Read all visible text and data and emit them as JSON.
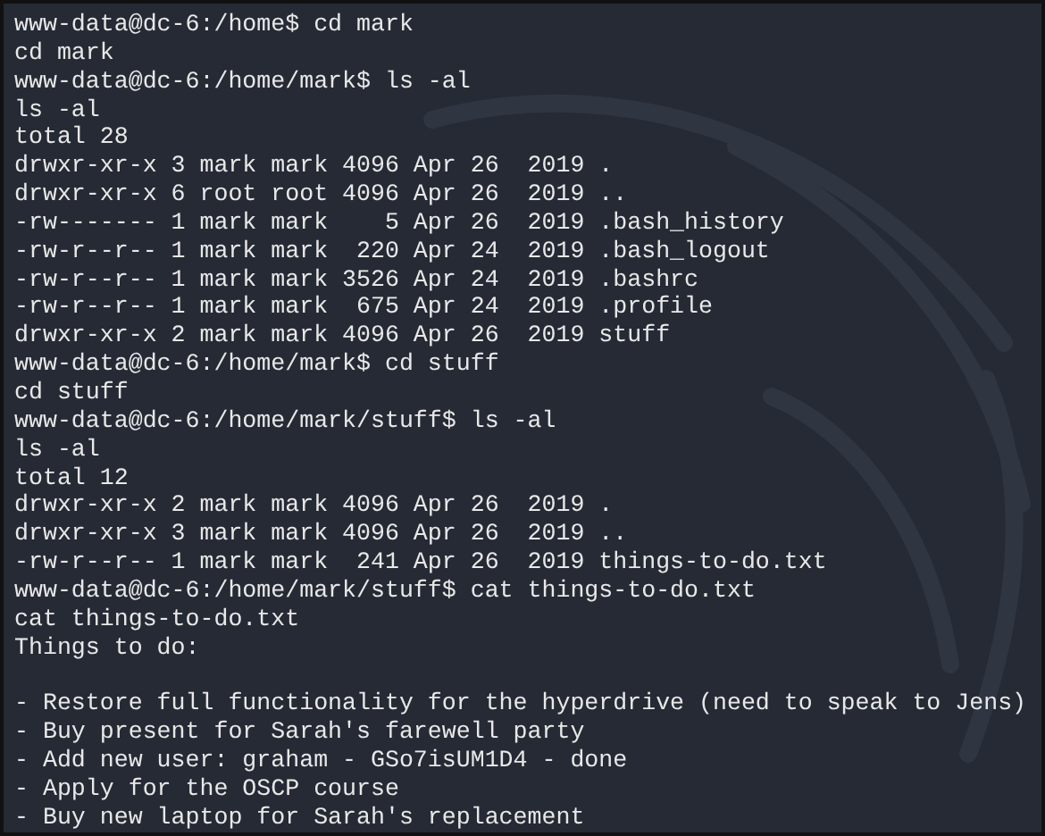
{
  "terminal": {
    "lines": [
      {
        "kind": "line",
        "text": "www-data@dc-6:/home$ cd mark"
      },
      {
        "kind": "line",
        "text": "cd mark"
      },
      {
        "kind": "line",
        "text": "www-data@dc-6:/home/mark$ ls -al"
      },
      {
        "kind": "line",
        "text": "ls -al"
      },
      {
        "kind": "line",
        "text": "total 28"
      },
      {
        "kind": "line",
        "text": "drwxr-xr-x 3 mark mark 4096 Apr 26  2019 ."
      },
      {
        "kind": "line",
        "text": "drwxr-xr-x 6 root root 4096 Apr 26  2019 .."
      },
      {
        "kind": "line",
        "text": "-rw------- 1 mark mark    5 Apr 26  2019 .bash_history"
      },
      {
        "kind": "line",
        "text": "-rw-r--r-- 1 mark mark  220 Apr 24  2019 .bash_logout"
      },
      {
        "kind": "line",
        "text": "-rw-r--r-- 1 mark mark 3526 Apr 24  2019 .bashrc"
      },
      {
        "kind": "line",
        "text": "-rw-r--r-- 1 mark mark  675 Apr 24  2019 .profile"
      },
      {
        "kind": "line",
        "text": "drwxr-xr-x 2 mark mark 4096 Apr 26  2019 stuff"
      },
      {
        "kind": "line",
        "text": "www-data@dc-6:/home/mark$ cd stuff"
      },
      {
        "kind": "line",
        "text": "cd stuff"
      },
      {
        "kind": "line",
        "text": "www-data@dc-6:/home/mark/stuff$ ls -al"
      },
      {
        "kind": "line",
        "text": "ls -al"
      },
      {
        "kind": "line",
        "text": "total 12"
      },
      {
        "kind": "line",
        "text": "drwxr-xr-x 2 mark mark 4096 Apr 26  2019 ."
      },
      {
        "kind": "line",
        "text": "drwxr-xr-x 3 mark mark 4096 Apr 26  2019 .."
      },
      {
        "kind": "line",
        "text": "-rw-r--r-- 1 mark mark  241 Apr 26  2019 things-to-do.txt"
      },
      {
        "kind": "line",
        "text": "www-data@dc-6:/home/mark/stuff$ cat things-to-do.txt"
      },
      {
        "kind": "line",
        "text": "cat things-to-do.txt"
      },
      {
        "kind": "line",
        "text": "Things to do:"
      },
      {
        "kind": "blank"
      },
      {
        "kind": "line",
        "text": "- Restore full functionality for the hyperdrive (need to speak to Jens)"
      },
      {
        "kind": "line",
        "text": "- Buy present for Sarah's farewell party"
      },
      {
        "kind": "line",
        "text": "- Add new user: graham - GSo7isUM1D4 - done"
      },
      {
        "kind": "line",
        "text": "- Apply for the OSCP course"
      },
      {
        "kind": "line",
        "text": "- Buy new laptop for Sarah's replacement"
      }
    ]
  }
}
